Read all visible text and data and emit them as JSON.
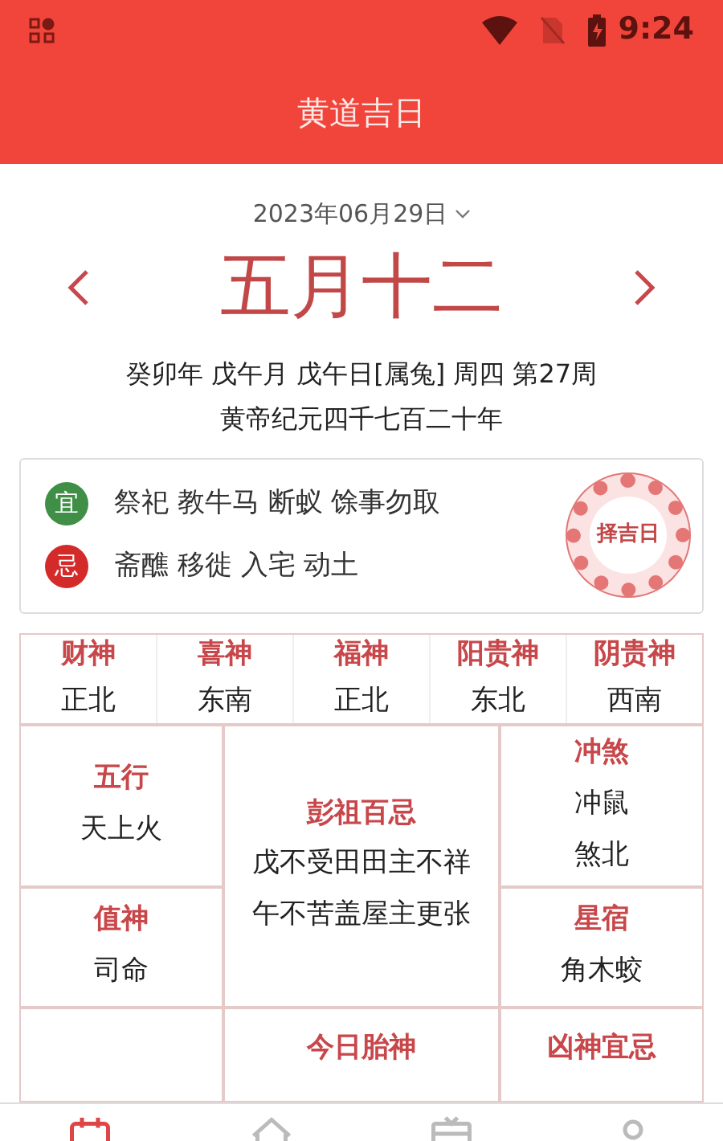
{
  "status_bar": {
    "time": "9:24"
  },
  "header": {
    "title": "黄道吉日"
  },
  "date_picker": {
    "solar_date": "2023年06月29日"
  },
  "lunar_date": "五月十二",
  "ganzhi_line": "癸卯年 戊午月 戊午日[属兔] 周四 第27周",
  "era_line": "黄帝纪元四千七百二十年",
  "yi_ji": {
    "rows": [
      {
        "badge": "宜",
        "text": "祭祀 教牛马 断蚁 馀事勿取",
        "color": "#3f8f47"
      },
      {
        "badge": "忌",
        "text": "斋醮 移徙 入宅 动土",
        "color": "#d42a2a"
      }
    ],
    "stamp": "择吉日"
  },
  "gods": [
    {
      "title": "财神",
      "value": "正北"
    },
    {
      "title": "喜神",
      "value": "东南"
    },
    {
      "title": "福神",
      "value": "正北"
    },
    {
      "title": "阳贵神",
      "value": "东北"
    },
    {
      "title": "阴贵神",
      "value": "西南"
    }
  ],
  "grid": {
    "wuxing": {
      "title": "五行",
      "lines": [
        "天上火"
      ]
    },
    "pengzu": {
      "title": "彭祖百忌",
      "lines": [
        "戊不受田田主不祥",
        "午不苦盖屋主更张"
      ]
    },
    "chongsha": {
      "title": "冲煞",
      "lines": [
        "冲鼠",
        "煞北"
      ]
    },
    "zhishen": {
      "title": "值神",
      "lines": [
        "司命"
      ]
    },
    "xingxiu": {
      "title": "星宿",
      "lines": [
        "角木蛟"
      ]
    },
    "taishen": {
      "title": "今日胎神"
    },
    "xiongshen": {
      "title": "凶神宜忌"
    }
  },
  "tabs": [
    {
      "kind": "calendar",
      "selected": true
    },
    {
      "kind": "home",
      "selected": false
    },
    {
      "kind": "almanac",
      "selected": false
    },
    {
      "kind": "person",
      "selected": false
    }
  ]
}
